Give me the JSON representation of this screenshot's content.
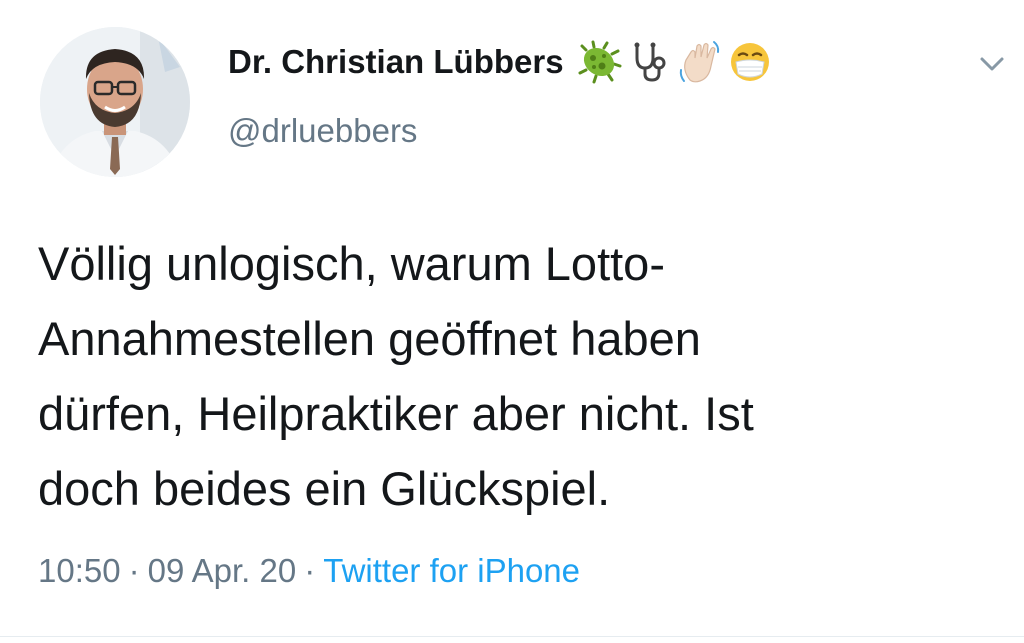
{
  "user": {
    "display_name": "Dr. Christian Lübbers",
    "handle": "@drluebbers",
    "name_emojis": [
      "microbe-icon",
      "stethoscope-icon",
      "waving-hand-icon",
      "face-with-mask-icon"
    ]
  },
  "tweet": {
    "lines": [
      "Völlig unlogisch, warum Lotto-",
      "Annahmestellen geöffnet haben",
      "dürfen, Heilpraktiker aber nicht. Ist",
      "doch beides ein Glückspiel."
    ],
    "time": "10:50",
    "date": "09 Apr. 20",
    "source": "Twitter for iPhone",
    "separator": "·"
  },
  "colors": {
    "text": "#14171a",
    "secondary": "#657786",
    "link": "#1da1f2"
  }
}
